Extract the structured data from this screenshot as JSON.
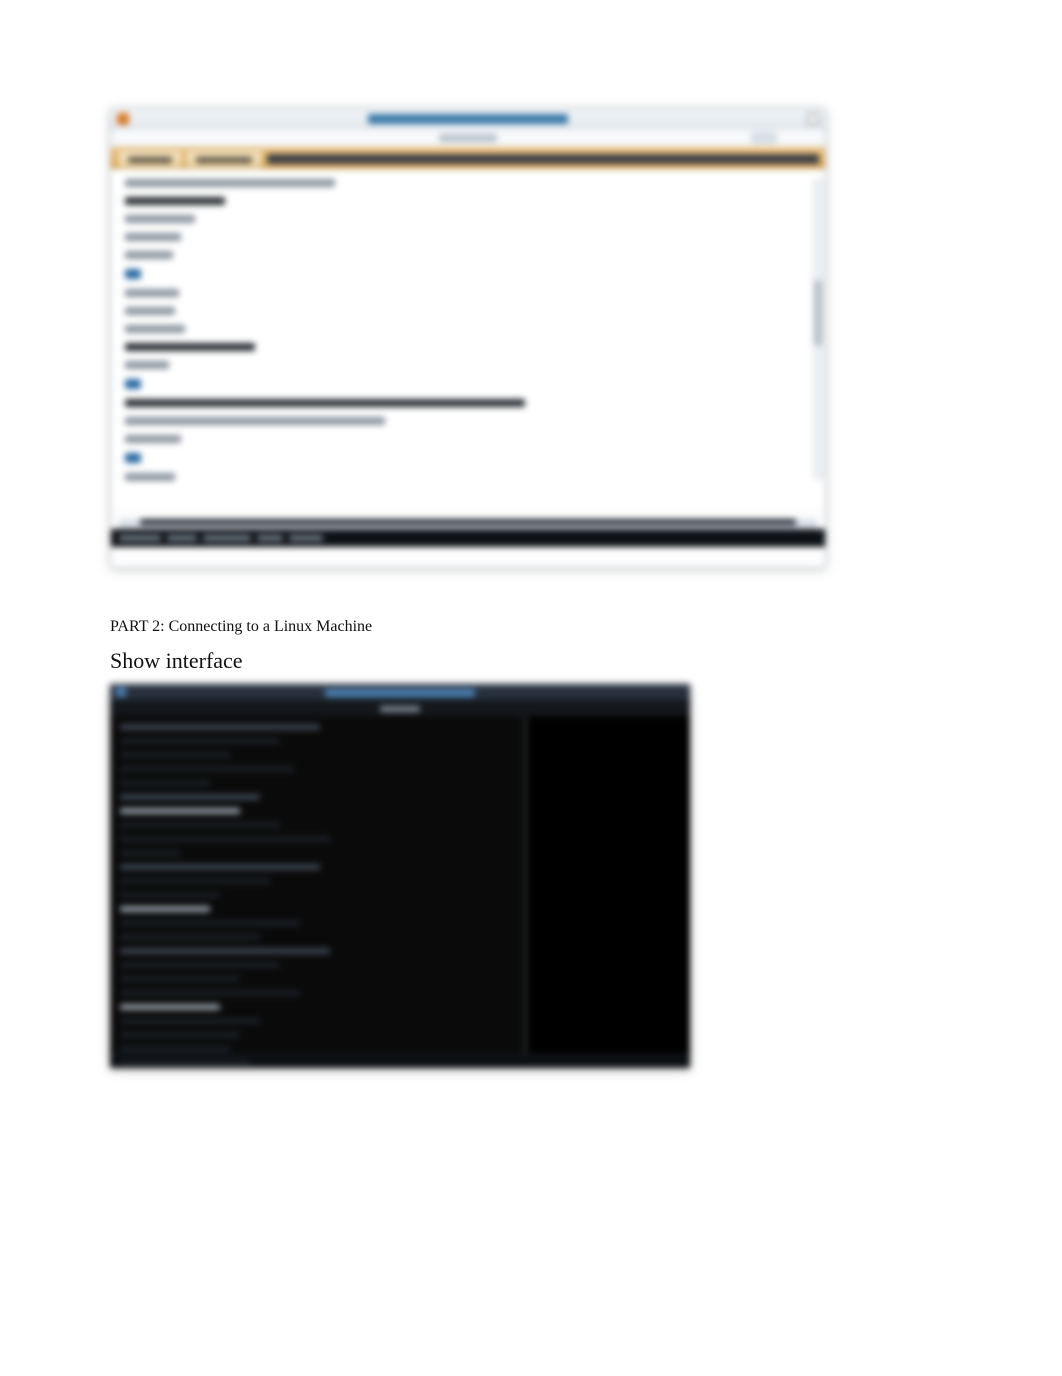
{
  "section": {
    "part_label": "PART 2: Connecting to a Linux Machine",
    "subheading": "Show interface"
  },
  "screenshot1": {
    "window_title": "",
    "tabs": [
      {
        "label": ""
      },
      {
        "label": ""
      }
    ],
    "code_lines": [
      "",
      "",
      "",
      "",
      "",
      "",
      "",
      "",
      "",
      "",
      "",
      "",
      "",
      "",
      "",
      "",
      ""
    ],
    "status_items": [
      "",
      "",
      "",
      "",
      ""
    ]
  },
  "screenshot2": {
    "window_title": "",
    "terminal_lines": [
      "",
      "",
      "",
      "",
      "",
      "",
      "",
      "",
      "",
      "",
      "",
      "",
      "",
      "",
      "",
      "",
      "",
      "",
      "",
      "",
      "",
      "",
      "",
      "",
      "",
      ""
    ]
  }
}
